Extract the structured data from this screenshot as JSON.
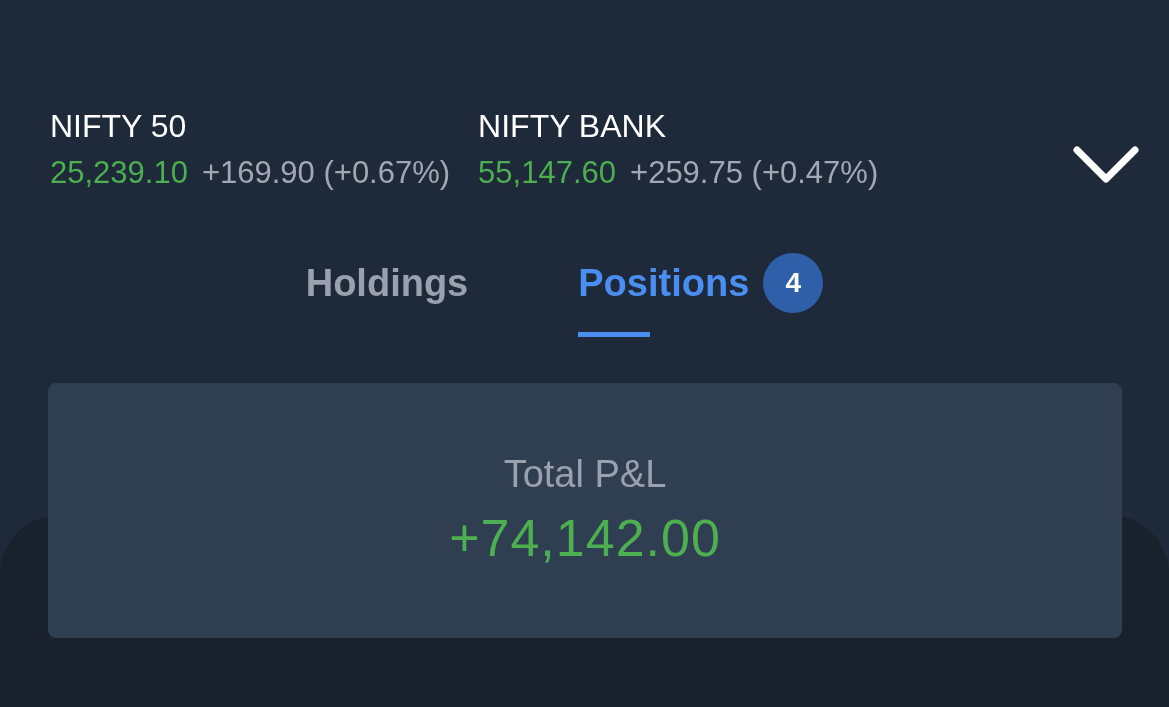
{
  "indices": [
    {
      "name": "NIFTY 50",
      "value": "25,239.10",
      "change": "+169.90 (+0.67%)"
    },
    {
      "name": "NIFTY BANK",
      "value": "55,147.60",
      "change": "+259.75 (+0.47%)"
    }
  ],
  "tabs": [
    {
      "label": "Holdings",
      "selected": false
    },
    {
      "label": "Positions",
      "selected": true,
      "badge": "4"
    }
  ],
  "summary": {
    "label": "Total P&L",
    "value": "+74,142.00"
  }
}
